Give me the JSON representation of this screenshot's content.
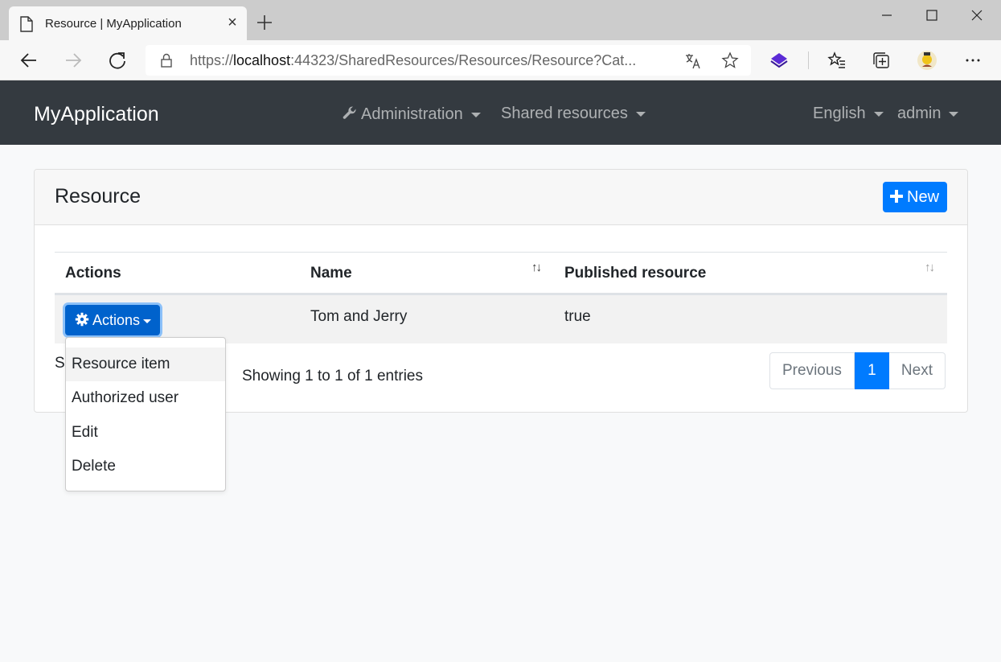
{
  "browser": {
    "tab_title": "Resource | MyApplication",
    "tab_close": "×",
    "url_scheme": "https://",
    "url_host": "localhost",
    "url_rest": ":44323/SharedResources/Resources/Resource?Cat..."
  },
  "navbar": {
    "brand": "MyApplication",
    "administration": "Administration",
    "shared_resources": "Shared resources",
    "language": "English",
    "user": "admin"
  },
  "card": {
    "title": "Resource",
    "new_button": "New"
  },
  "table": {
    "headers": [
      "Actions",
      "Name",
      "Published resource"
    ],
    "sort_icon": "↑↓",
    "rows": [
      {
        "actions_button": "Actions",
        "name": "Tom and Jerry",
        "published": "true"
      }
    ],
    "info_fragment": "Sl",
    "info": "Showing 1 to 1 of 1 entries"
  },
  "pagination": {
    "previous": "Previous",
    "current": "1",
    "next": "Next"
  },
  "dropdown": {
    "items": [
      "Resource item",
      "Authorized user",
      "Edit",
      "Delete"
    ]
  }
}
